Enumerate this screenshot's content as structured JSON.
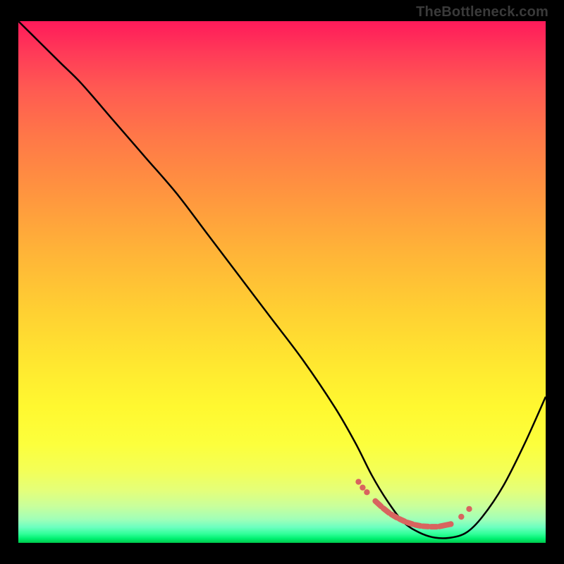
{
  "watermark": "TheBottleneck.com",
  "chart_data": {
    "type": "line",
    "title": "",
    "xlabel": "",
    "ylabel": "",
    "xlim": [
      0,
      100
    ],
    "ylim": [
      0,
      100
    ],
    "grid": false,
    "legend": false,
    "gradient_stops": [
      {
        "pct": 0,
        "color": "#ff1a5a"
      },
      {
        "pct": 6,
        "color": "#ff3a58"
      },
      {
        "pct": 13,
        "color": "#ff5a52"
      },
      {
        "pct": 22,
        "color": "#ff7748"
      },
      {
        "pct": 32,
        "color": "#ff9240"
      },
      {
        "pct": 44,
        "color": "#ffb338"
      },
      {
        "pct": 56,
        "color": "#ffd132"
      },
      {
        "pct": 66,
        "color": "#ffe830"
      },
      {
        "pct": 74,
        "color": "#fff830"
      },
      {
        "pct": 81,
        "color": "#fcff3c"
      },
      {
        "pct": 86,
        "color": "#f4ff56"
      },
      {
        "pct": 90,
        "color": "#e4ff7a"
      },
      {
        "pct": 93,
        "color": "#c8ff9c"
      },
      {
        "pct": 95.5,
        "color": "#a0ffb8"
      },
      {
        "pct": 97,
        "color": "#6cffc0"
      },
      {
        "pct": 98.3,
        "color": "#30ff98"
      },
      {
        "pct": 99.2,
        "color": "#00f070"
      },
      {
        "pct": 100,
        "color": "#00c84c"
      }
    ],
    "series": [
      {
        "name": "curve",
        "color": "#000000",
        "x": [
          0,
          4,
          8,
          12,
          18,
          24,
          30,
          36,
          42,
          48,
          54,
          60,
          64,
          67,
          70,
          73,
          76,
          79,
          82,
          85,
          88,
          92,
          96,
          100
        ],
        "y": [
          100,
          96,
          92,
          88,
          81,
          74,
          67,
          59,
          51,
          43,
          35,
          26,
          19,
          13,
          8,
          4,
          2,
          1,
          1,
          2,
          5,
          11,
          19,
          28
        ]
      },
      {
        "name": "dots",
        "type": "scatter",
        "color": "#d8645f",
        "x": [
          64.5,
          65.3,
          66.1,
          67.5,
          69.0,
          70.5,
          72.0,
          73.5,
          75.0,
          76.5,
          78.0,
          79.6,
          82.0,
          84.0,
          85.5
        ],
        "y": [
          11.7,
          10.6,
          9.7,
          8.2,
          6.8,
          5.6,
          4.7,
          4.0,
          3.5,
          3.2,
          3.1,
          3.1,
          3.6,
          5.0,
          6.5
        ]
      }
    ]
  }
}
